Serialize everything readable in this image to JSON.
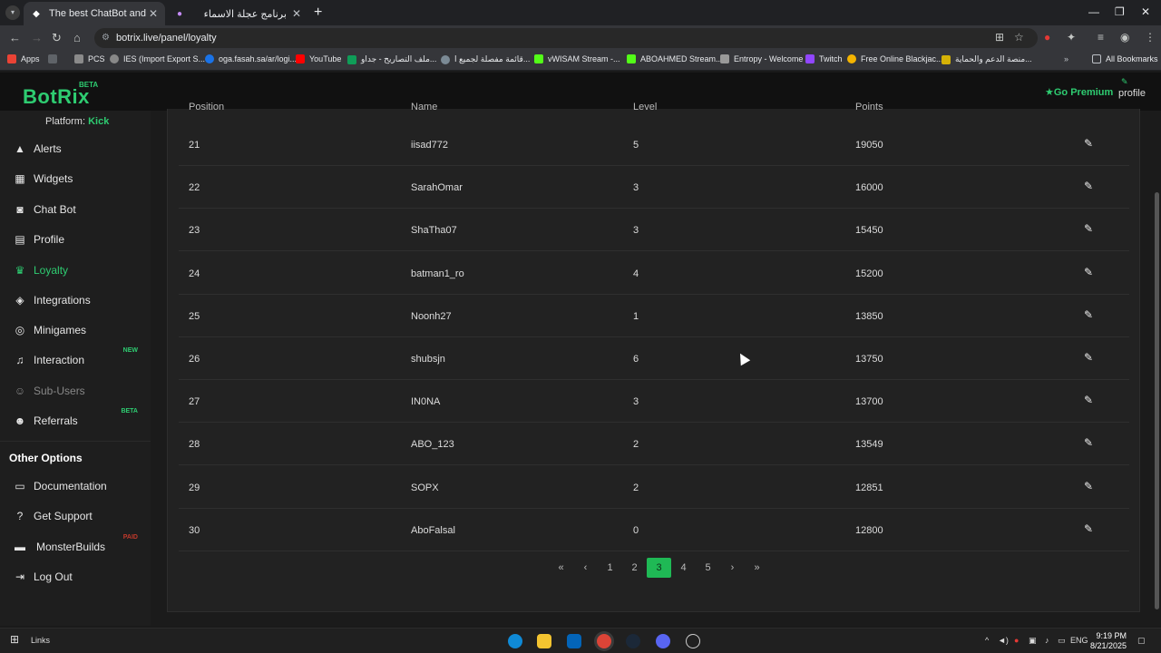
{
  "browser": {
    "tabs": [
      {
        "title": "The best ChatBot and Widgets"
      },
      {
        "title": "برنامج عجلة الاسماء"
      }
    ],
    "url": "botrix.live/panel/loyalty",
    "bookmarks": [
      {
        "label": "Apps",
        "color": "#ea4335"
      },
      {
        "label": "PCS",
        "color": "#e8eaed"
      },
      {
        "label": "IES (Import Export S...",
        "color": "#888888"
      },
      {
        "label": "oga.fasah.sa/ar/logi...",
        "color": "#1a73e8"
      },
      {
        "label": "YouTube",
        "color": "#ff0000"
      },
      {
        "label": "ملف التصاريح - جداو...",
        "color": "#0f9d58"
      },
      {
        "label": "قائمة مفصلة لجميع ا...",
        "color": "#7b8a95"
      },
      {
        "label": "vWISAM Stream -...",
        "color": "#53fc18"
      },
      {
        "label": "ABOAHMED Stream...",
        "color": "#53fc18"
      },
      {
        "label": "Entropy - Welcome",
        "color": "#999999"
      },
      {
        "label": "Twitch",
        "color": "#9146ff"
      },
      {
        "label": "Free Online Blackjac...",
        "color": "#f4b400"
      },
      {
        "label": "منصة الدعم والحماية...",
        "color": "#d4b106"
      },
      {
        "label": "All Bookmarks",
        "color": "#bdc1c6"
      }
    ]
  },
  "header": {
    "logo": "BotRix",
    "logo_badge": "BETA",
    "premium": "Go Premium",
    "profile": "profile"
  },
  "sidebar": {
    "platform_label": "Platform:",
    "platform_value": "Kick",
    "items": [
      {
        "label": "Alerts",
        "icon": "warning-icon"
      },
      {
        "label": "Widgets",
        "icon": "grid-icon"
      },
      {
        "label": "Chat Bot",
        "icon": "robot-icon"
      },
      {
        "label": "Profile",
        "icon": "id-card-icon"
      },
      {
        "label": "Loyalty",
        "icon": "trophy-icon"
      },
      {
        "label": "Integrations",
        "icon": "cube-icon"
      },
      {
        "label": "Minigames",
        "icon": "gamepad-icon"
      },
      {
        "label": "Interaction",
        "icon": "music-icon",
        "badge": "NEW"
      },
      {
        "label": "Sub-Users",
        "icon": "users-icon"
      },
      {
        "label": "Referrals",
        "icon": "referral-icon",
        "badge": "BETA"
      }
    ],
    "other_options_title": "Other Options",
    "other_items": [
      {
        "label": "Documentation",
        "icon": "book-icon"
      },
      {
        "label": "Get Support",
        "icon": "question-icon"
      },
      {
        "label": "MonsterBuilds",
        "icon": "laptop-icon",
        "badge": "PAID"
      },
      {
        "label": "Log Out",
        "icon": "logout-icon"
      }
    ],
    "accent": "#2ecc71"
  },
  "table": {
    "columns": [
      "Position",
      "Name",
      "Level",
      "Points"
    ],
    "rows": [
      {
        "position": "21",
        "name": "iisad772",
        "level": "5",
        "points": "19050"
      },
      {
        "position": "22",
        "name": "SarahOmar",
        "level": "3",
        "points": "16000"
      },
      {
        "position": "23",
        "name": "ShaTha07",
        "level": "3",
        "points": "15450"
      },
      {
        "position": "24",
        "name": "batman1_ro",
        "level": "4",
        "points": "15200"
      },
      {
        "position": "25",
        "name": "Noonh27",
        "level": "1",
        "points": "13850"
      },
      {
        "position": "26",
        "name": "shubsjn",
        "level": "6",
        "points": "13750"
      },
      {
        "position": "27",
        "name": "IN0NA",
        "level": "3",
        "points": "13700"
      },
      {
        "position": "28",
        "name": "ABO_123",
        "level": "2",
        "points": "13549"
      },
      {
        "position": "29",
        "name": "SOPX",
        "level": "2",
        "points": "12851"
      },
      {
        "position": "30",
        "name": "AboFalsal",
        "level": "0",
        "points": "12800"
      }
    ]
  },
  "pagination": {
    "first": "«",
    "prev": "‹",
    "pages": [
      "1",
      "2",
      "3",
      "4",
      "5"
    ],
    "current": "3",
    "next": "›",
    "last": "»"
  },
  "taskbar": {
    "search_label": "Links",
    "lang": "ENG",
    "time": "9:19 PM",
    "date": "8/21/2025"
  }
}
